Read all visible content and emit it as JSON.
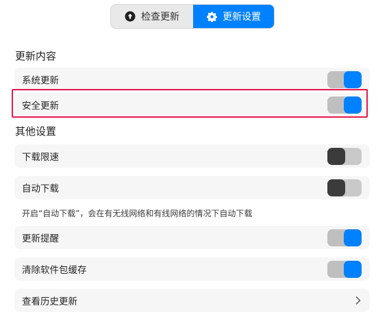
{
  "tabs": {
    "check_update": "检查更新",
    "update_settings": "更新设置",
    "active": "update_settings"
  },
  "sections": {
    "update_content": "更新内容",
    "other_settings": "其他设置"
  },
  "settings": {
    "system_update": {
      "label": "系统更新",
      "enabled": true
    },
    "security_update": {
      "label": "安全更新",
      "enabled": true
    },
    "download_limit": {
      "label": "下载限速",
      "enabled": false
    },
    "auto_download": {
      "label": "自动下载",
      "enabled": false
    },
    "auto_download_hint": "开启“自动下载”，会在有无线网络和有线网络的情况下自动下载",
    "update_reminder": {
      "label": "更新提醒",
      "enabled": true
    },
    "clear_cache": {
      "label": "清除软件包缓存",
      "enabled": true
    },
    "history": {
      "label": "查看历史更新"
    }
  },
  "colors": {
    "accent": "#0081ff",
    "highlight": "#e5194f"
  }
}
